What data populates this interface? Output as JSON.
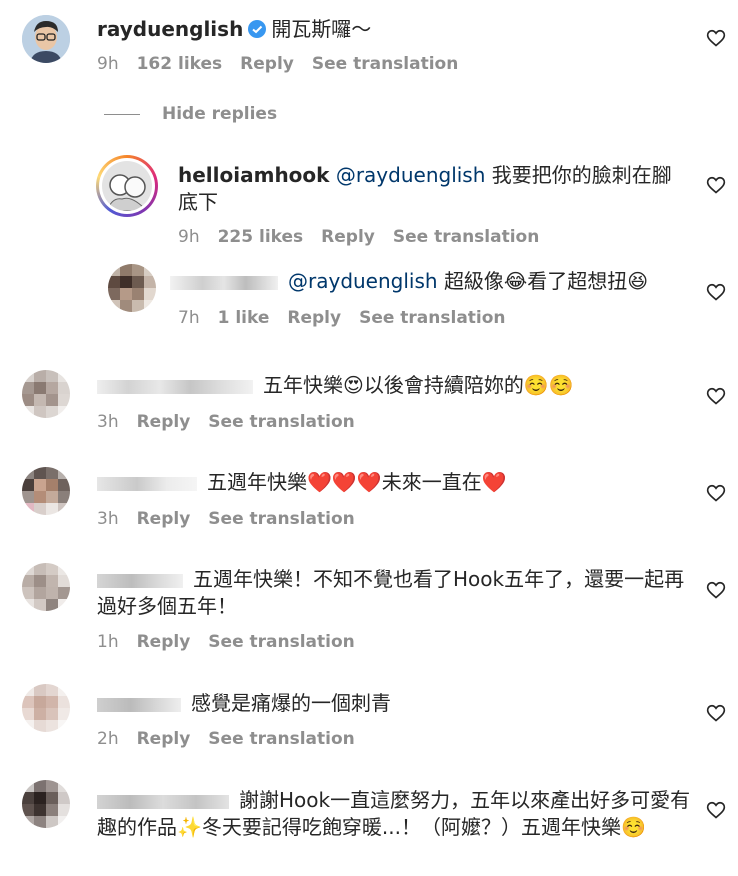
{
  "common": {
    "reply_label": "Reply",
    "see_translation_label": "See translation"
  },
  "comments": [
    {
      "username": "rayduenglish",
      "verified": true,
      "text": "開瓦斯囉～",
      "time": "9h",
      "likes": "162 likes"
    }
  ],
  "hide_replies_label": "Hide replies",
  "replies": [
    {
      "username": "helloiamhook",
      "mention": "@rayduenglish",
      "text": "我要把你的臉刺在腳底下",
      "time": "9h",
      "likes": "225 likes"
    },
    {
      "mention": "@rayduenglish",
      "text": "超級像😂看了超想扭😆",
      "time": "7h",
      "likes": "1 like"
    }
  ],
  "other_comments": [
    {
      "text": "五年快樂😍以後會持續陪妳的☺️☺️",
      "time": "3h"
    },
    {
      "text": "五週年快樂❤️❤️❤️未來一直在❤️",
      "time": "3h"
    },
    {
      "text": "五週年快樂！不知不覺也看了Hook五年了，還要一起再過好多個五年！",
      "time": "1h"
    },
    {
      "text": "感覺是痛爆的一個刺青",
      "time": "2h"
    },
    {
      "text": "謝謝Hook一直這麼努力，五年以來產出好多可愛有趣的作品✨冬天要記得吃飽穿暖...！（阿嬤？）五週年快樂☺️",
      "time": ""
    }
  ]
}
